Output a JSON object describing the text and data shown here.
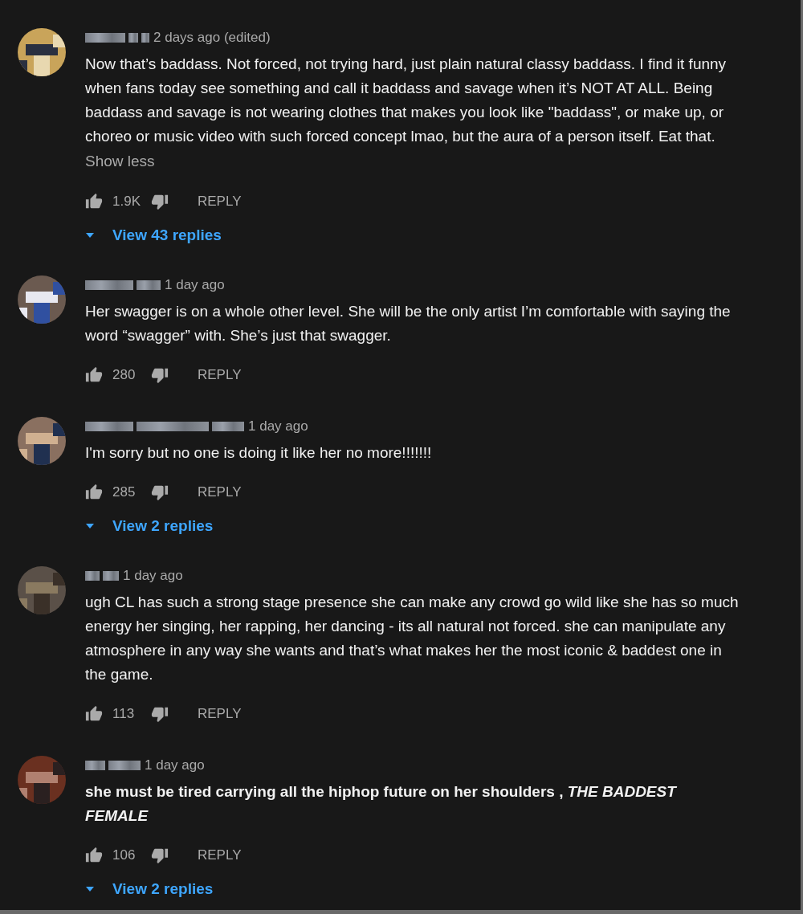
{
  "comments": [
    {
      "time": "2 days ago (edited)",
      "text": "Now that’s baddass. Not forced, not trying hard, just plain natural classy baddass. I find it funny when fans today see something and call it baddass and savage when it’s NOT AT ALL. Being baddass and savage is not wearing clothes that makes you look like \"baddass\", or make up, or choreo or music video with such forced concept lmao, but the aura of a person itself. Eat that.",
      "bold": false,
      "toggle": "Show less",
      "likes": "1.9K",
      "reply": "REPLY",
      "replies": "View 43 replies"
    },
    {
      "time": "1 day ago",
      "text": "Her swagger is on a whole other level. She will be the only artist I’m comfortable with saying the word “swagger” with. She’s just that swagger.",
      "bold": false,
      "likes": "280",
      "reply": "REPLY"
    },
    {
      "time": "1 day ago",
      "text": "I'm sorry but no one is doing it like her no more!!!!!!!",
      "bold": false,
      "likes": "285",
      "reply": "REPLY",
      "replies": "View 2 replies"
    },
    {
      "time": "1 day ago",
      "text": "ugh CL has such a strong stage presence she can make any crowd go wild like she has so much energy her singing, her rapping, her dancing - its all natural not forced. she can manipulate any atmosphere in any way she wants and that’s what makes her the most iconic & baddest one in the game.",
      "bold": false,
      "likes": "113",
      "reply": "REPLY"
    },
    {
      "time": "1 day ago",
      "text": "she must be tired carrying all the hiphop future on her shoulders , *THE BADDEST FEMALE*",
      "bold": true,
      "likes": "106",
      "reply": "REPLY",
      "replies": "View 2 replies"
    }
  ]
}
